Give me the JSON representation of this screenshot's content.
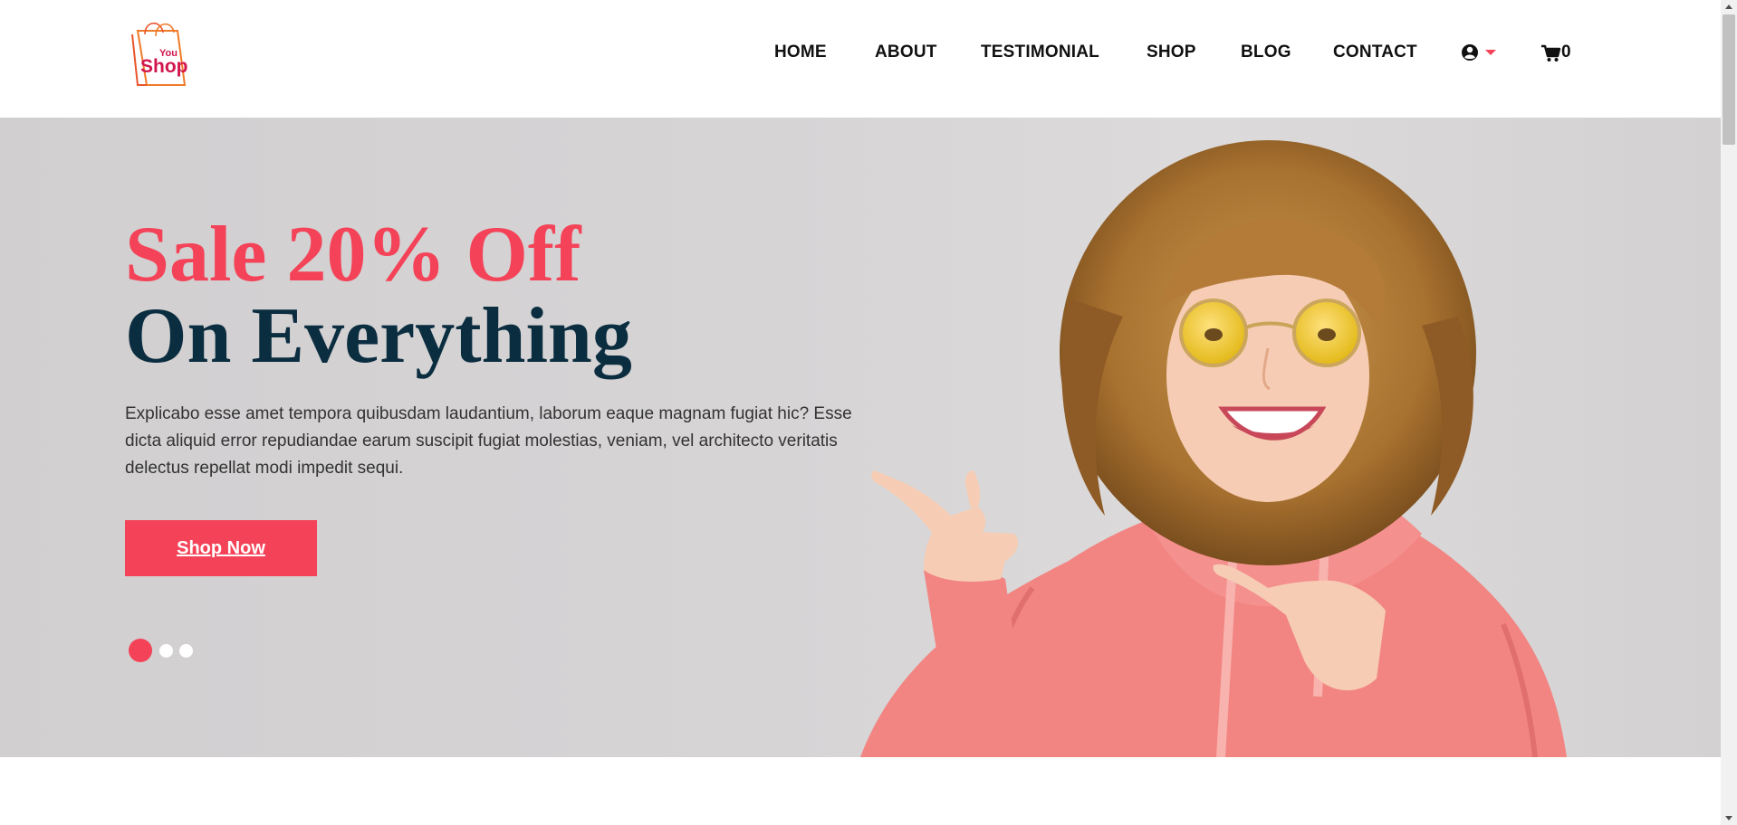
{
  "logo": {
    "small_text": "You",
    "brand_text": "Shop"
  },
  "nav": {
    "items": [
      {
        "label": "HOME"
      },
      {
        "label": "ABOUT"
      },
      {
        "label": "TESTIMONIAL"
      },
      {
        "label": "SHOP"
      },
      {
        "label": "BLOG"
      },
      {
        "label": "CONTACT"
      }
    ],
    "user_icon": "user-circle-icon",
    "dropdown_icon": "caret-down-icon",
    "cart_icon": "shopping-cart-icon",
    "cart_count": "0"
  },
  "hero": {
    "headline_accent": "Sale 20% Off",
    "headline_main": "On Everything",
    "description": "Explicabo esse amet tempora quibusdam laudantium, laborum eaque magnam fugiat hic? Esse dicta aliquid error repudiandae earum suscipit fugiat molestias, veniam, vel architecto veritatis delectus repellat modi impedit sequi.",
    "cta_label": "Shop Now",
    "slides": {
      "count": 3,
      "active": 1
    },
    "image_icon": "woman-pointing-image"
  },
  "colors": {
    "accent": "#f44358",
    "headline_dark": "#0b2d40",
    "hero_background": "#d5d3d4",
    "nav_text": "#111111"
  }
}
